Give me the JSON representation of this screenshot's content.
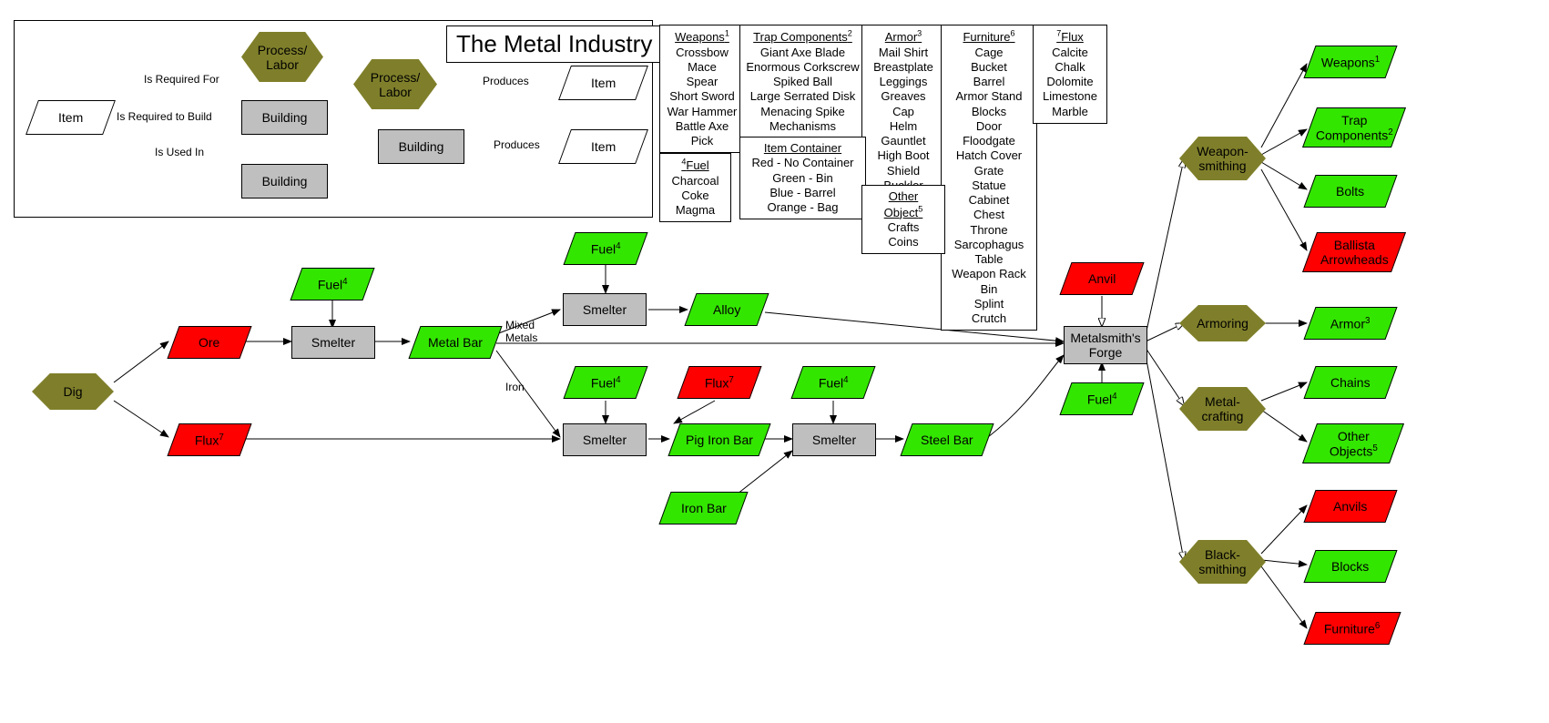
{
  "title": "The Metal Industry",
  "legend": {
    "item": "Item",
    "process": "Process/\nLabor",
    "building": "Building",
    "building2": "Building",
    "process2": "Process/\nLabor",
    "building3": "Building",
    "item2": "Item",
    "item3": "Item",
    "req_for": "Is Required For",
    "req_build": "Is Required to Build",
    "used_in": "Is Used In",
    "produces1": "Produces",
    "produces2": "Produces"
  },
  "info_boxes": {
    "weapons": {
      "h": "Weapons",
      "sup": "1",
      "items": [
        "Crossbow",
        "Mace",
        "Spear",
        "Short Sword",
        "War Hammer",
        "Battle Axe",
        "Pick"
      ]
    },
    "trap": {
      "h": "Trap Components",
      "sup": "2",
      "items": [
        "Giant Axe Blade",
        "Enormous Corkscrew",
        "Spiked Ball",
        "Large Serrated Disk",
        "Menacing Spike",
        "Mechanisms"
      ]
    },
    "armor": {
      "h": "Armor",
      "sup": "3",
      "items": [
        "Mail Shirt",
        "Breastplate",
        "Leggings",
        "Greaves",
        "Cap",
        "Helm",
        "Gauntlet",
        "High Boot",
        "Shield",
        "Buckler"
      ]
    },
    "furniture": {
      "h": "Furniture",
      "sup": "6",
      "items": [
        "Cage",
        "Bucket",
        "Barrel",
        "Armor Stand",
        "Blocks",
        "Door",
        "Floodgate",
        "Hatch Cover",
        "Grate",
        "Statue",
        "Cabinet",
        "Chest",
        "Throne",
        "Sarcophagus",
        "Table",
        "Weapon Rack",
        "Bin",
        "Splint",
        "Crutch"
      ]
    },
    "flux": {
      "h": "Flux",
      "sup": "7",
      "items": [
        "Calcite",
        "Chalk",
        "Dolomite",
        "Limestone",
        "Marble"
      ]
    },
    "fuel": {
      "h": "Fuel",
      "sup": "4",
      "items": [
        "Charcoal",
        "Coke",
        "Magma"
      ]
    },
    "container": {
      "h": "Item Container",
      "items": [
        "Red - No Container",
        "Green - Bin",
        "Blue - Barrel",
        "Orange - Bag"
      ]
    },
    "other": {
      "h": "Other Object",
      "sup": "5",
      "items": [
        "Crafts",
        "Coins"
      ]
    }
  },
  "nodes": {
    "dig": "Dig",
    "ore": "Ore",
    "fluxitem": "Flux",
    "flux_sup": "7",
    "fuel1": "Fuel",
    "fuel_sup": "4",
    "smelter1": "Smelter",
    "metalbar": "Metal Bar",
    "fuel2": "Fuel",
    "smelter2": "Smelter",
    "alloy": "Alloy",
    "fuel3": "Fuel",
    "flux2": "Flux",
    "smelter3": "Smelter",
    "pigiron": "Pig Iron Bar",
    "fuel4": "Fuel",
    "smelter4": "Smelter",
    "steelbar": "Steel Bar",
    "ironbar": "Iron Bar",
    "anvil": "Anvil",
    "forge": "Metalsmith's\nForge",
    "fuel5": "Fuel",
    "mixed_metals": "Mixed\nMetals",
    "iron_lbl": "Iron",
    "weaponsmithing": "Weapon-\nsmithing",
    "armoring": "Armoring",
    "metalcrafting": "Metal-\ncrafting",
    "blacksmithing": "Black-\nsmithing",
    "out_weapons": "Weapons",
    "out_weapons_sup": "1",
    "out_trap": "Trap\nComponents",
    "out_trap_sup": "2",
    "out_bolts": "Bolts",
    "out_ballista": "Ballista\nArrowheads",
    "out_armor": "Armor",
    "out_armor_sup": "3",
    "out_chains": "Chains",
    "out_other": "Other\nObjects",
    "out_other_sup": "5",
    "out_anvils": "Anvils",
    "out_blocks": "Blocks",
    "out_furniture": "Furniture",
    "out_furniture_sup": "6"
  },
  "connectors": [
    {
      "from": "item-legend",
      "to": "process-legend",
      "type": "open",
      "label": "req_for"
    },
    {
      "from": "item-legend",
      "to": "building-legend",
      "type": "open",
      "label": "req_build"
    },
    {
      "from": "item-legend",
      "to": "building2-legend",
      "type": "solid",
      "label": "used_in"
    },
    {
      "from": "process2-legend",
      "to": "item2-legend",
      "type": "solid",
      "label": "produces1"
    },
    {
      "from": "building3-legend",
      "to": "item3-legend",
      "type": "solid",
      "label": "produces2"
    }
  ]
}
